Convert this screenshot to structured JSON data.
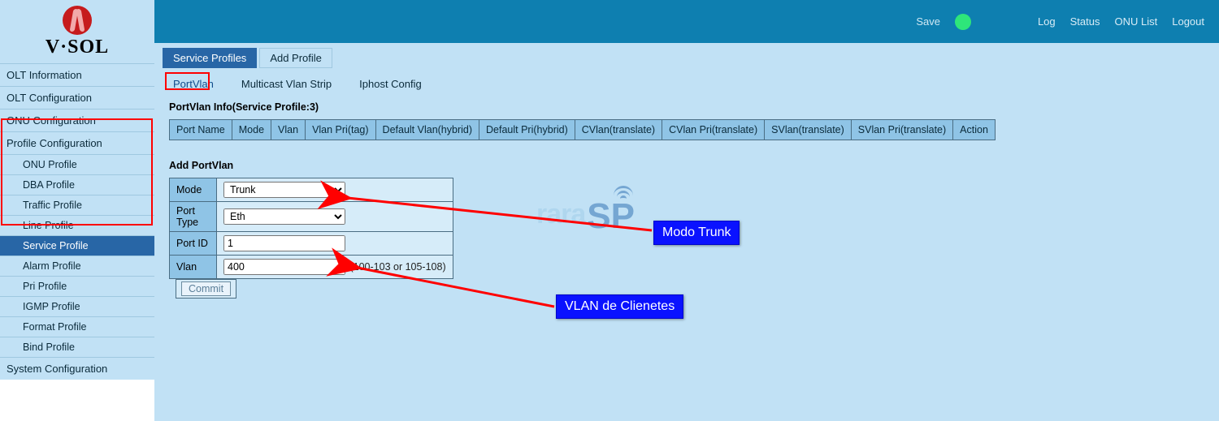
{
  "brand": {
    "text": "V·SOL"
  },
  "topbar": {
    "save": "Save",
    "links": {
      "log": "Log",
      "status": "Status",
      "onu_list": "ONU List",
      "logout": "Logout"
    }
  },
  "sidebar": {
    "heads": {
      "olt_info": "OLT Information",
      "olt_conf": "OLT Configuration",
      "onu_conf": "ONU Configuration",
      "profile_conf": "Profile Configuration",
      "sys_conf": "System Configuration"
    },
    "profile_subs": {
      "onu": "ONU Profile",
      "dba": "DBA Profile",
      "traffic": "Traffic Profile",
      "line": "Line Profile",
      "service": "Service Profile",
      "alarm": "Alarm Profile",
      "pri": "Pri Profile",
      "igmp": "IGMP Profile",
      "format": "Format Profile",
      "bind": "Bind Profile"
    }
  },
  "tabs1": {
    "service_profiles": "Service Profiles",
    "add_profile": "Add Profile"
  },
  "tabs2": {
    "portvlan": "PortVlan",
    "mcast": "Multicast Vlan Strip",
    "iphost": "Iphost Config"
  },
  "section": {
    "info_title": "PortVlan Info(Service Profile:3)",
    "add_title": "Add PortVlan"
  },
  "cols": {
    "port_name": "Port Name",
    "mode": "Mode",
    "vlan": "Vlan",
    "vlan_pri": "Vlan Pri(tag)",
    "def_vlan": "Default Vlan(hybrid)",
    "def_pri": "Default Pri(hybrid)",
    "cvlan_t": "CVlan(translate)",
    "cvlan_pri_t": "CVlan Pri(translate)",
    "svlan_t": "SVlan(translate)",
    "svlan_pri_t": "SVlan Pri(translate)",
    "action": "Action"
  },
  "form": {
    "labels": {
      "mode": "Mode",
      "port_type": "Port Type",
      "port_id": "Port ID",
      "vlan": "Vlan"
    },
    "mode": {
      "selected": "Trunk",
      "options": [
        "Trunk"
      ]
    },
    "port_type": {
      "selected": "Eth",
      "options": [
        "Eth"
      ]
    },
    "port_id": "1",
    "vlan": "400",
    "vlan_hint": "(100-103 or 105-108)",
    "commit": "Commit"
  },
  "annotations": {
    "modo": "Modo Trunk",
    "vlan": "VLAN de Clienetes"
  },
  "watermark": {
    "left": "rara",
    "right": "SP"
  }
}
